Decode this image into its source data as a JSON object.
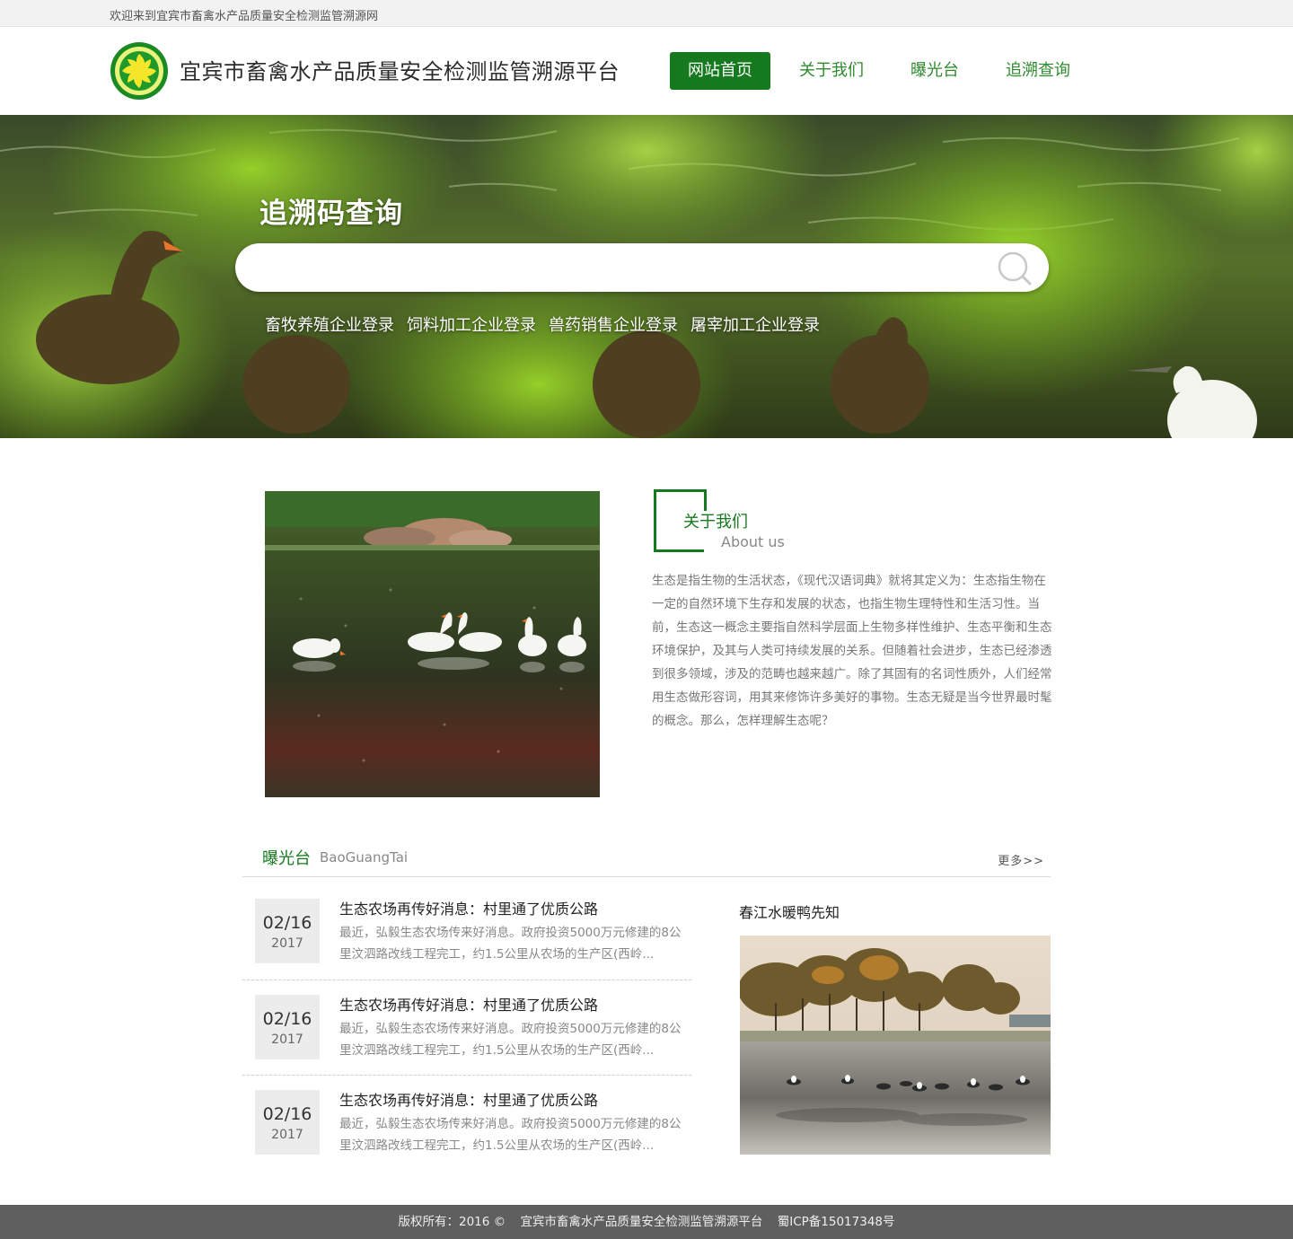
{
  "topbar": {
    "welcome": "欢迎来到宜宾市畜禽水产品质量安全检测监管溯源网"
  },
  "header": {
    "site_title": "宜宾市畜禽水产品质量安全检测监管溯源平台",
    "nav": [
      "网站首页",
      "关于我们",
      "曝光台",
      "追溯查询"
    ],
    "active_nav": "网站首页"
  },
  "banner": {
    "title": "追溯码查询",
    "search": {
      "value": "",
      "placeholder": ""
    },
    "login_links": [
      "畜牧养殖企业登录",
      "饲料加工企业登录",
      "兽药销售企业登录",
      "屠宰加工企业登录"
    ]
  },
  "about": {
    "title": "关于我们",
    "subtitle": "About us",
    "text": "生态是指生物的生活状态，《现代汉语词典》就将其定义为：生态指生物在一定的自然环境下生存和发展的状态，也指生物生理特性和生活习性。当前，生态这一概念主要指自然科学层面上生物多样性维护、生态平衡和生态环境保护，及其与人类可持续发展的关系。但随着社会进步，生态已经渗透到很多领域，涉及的范畴也越来越广。除了其固有的名词性质外，人们经常用生态做形容词，用其来修饰许多美好的事物。生态无疑是当今世界最时髦的概念。那么，怎样理解生态呢？"
  },
  "exposure": {
    "title": "曝光台",
    "subtitle": "BaoGuangTai",
    "more": "更多>>",
    "news": [
      {
        "date": "02/16",
        "year": "2017",
        "title": "生态农场再传好消息：村里通了优质公路",
        "desc": "最近，弘毅生态农场传来好消息。政府投资5000万元修建的8公里汶泗路改线工程完工，约1.5公里从农场的生产区(西岭..."
      },
      {
        "date": "02/16",
        "year": "2017",
        "title": "生态农场再传好消息：村里通了优质公路",
        "desc": "最近，弘毅生态农场传来好消息。政府投资5000万元修建的8公里汶泗路改线工程完工，约1.5公里从农场的生产区(西岭..."
      },
      {
        "date": "02/16",
        "year": "2017",
        "title": "生态农场再传好消息：村里通了优质公路",
        "desc": "最近，弘毅生态农场传来好消息。政府投资5000万元修建的8公里汶泗路改线工程完工，约1.5公里从农场的生产区(西岭..."
      }
    ],
    "feature_title": "春江水暖鸭先知"
  },
  "footer": {
    "copyright": "版权所有：2016  ©",
    "site_name": "宜宾市畜禽水产品质量安全检测监管溯源平台",
    "icp": "蜀ICP备15017348号"
  },
  "colors": {
    "brand_green": "#157a1d",
    "link_green": "#2e8b2e",
    "footer_bg": "#5f5f5f"
  }
}
